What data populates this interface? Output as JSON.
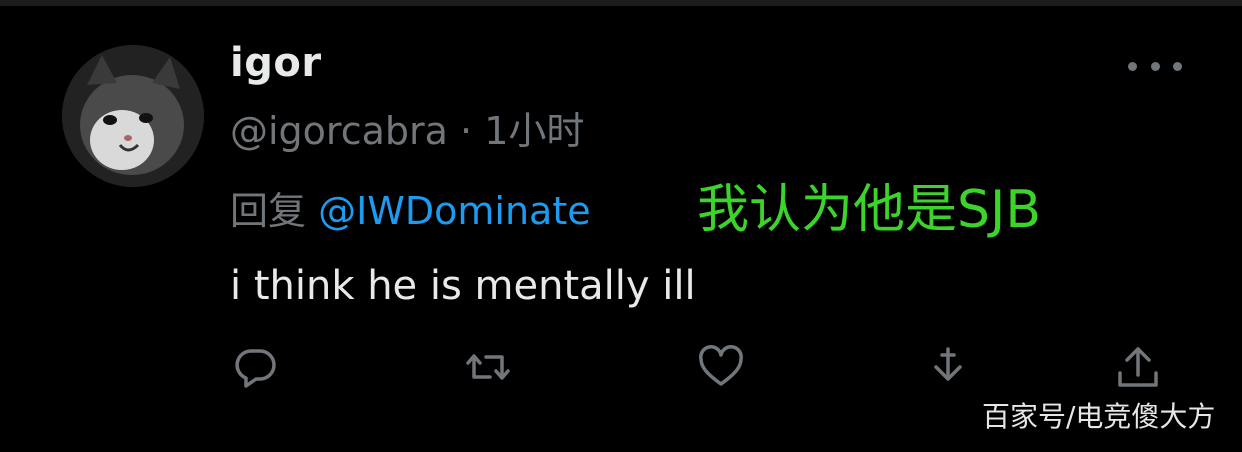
{
  "tweet": {
    "display_name": "igor",
    "handle": "@igorcabra",
    "separator": " · ",
    "time": "1小时",
    "reply_prefix": "回复 ",
    "reply_to": "@IWDominate",
    "text": "i think he is mentally ill"
  },
  "overlay": {
    "annotation": "我认为他是SJB",
    "annotation_color": "#3cd32a",
    "watermark": "百家号/电竞傻大方"
  },
  "icons": {
    "more": "more-horizontal-icon",
    "reply": "reply-bubble-icon",
    "retweet": "retweet-icon",
    "like": "heart-icon",
    "download": "download-arrow-icon",
    "share": "share-upload-icon"
  },
  "colors": {
    "background": "#000000",
    "primary_text": "#e7e9ea",
    "secondary_text": "#71767b",
    "link": "#1d9bf0"
  }
}
